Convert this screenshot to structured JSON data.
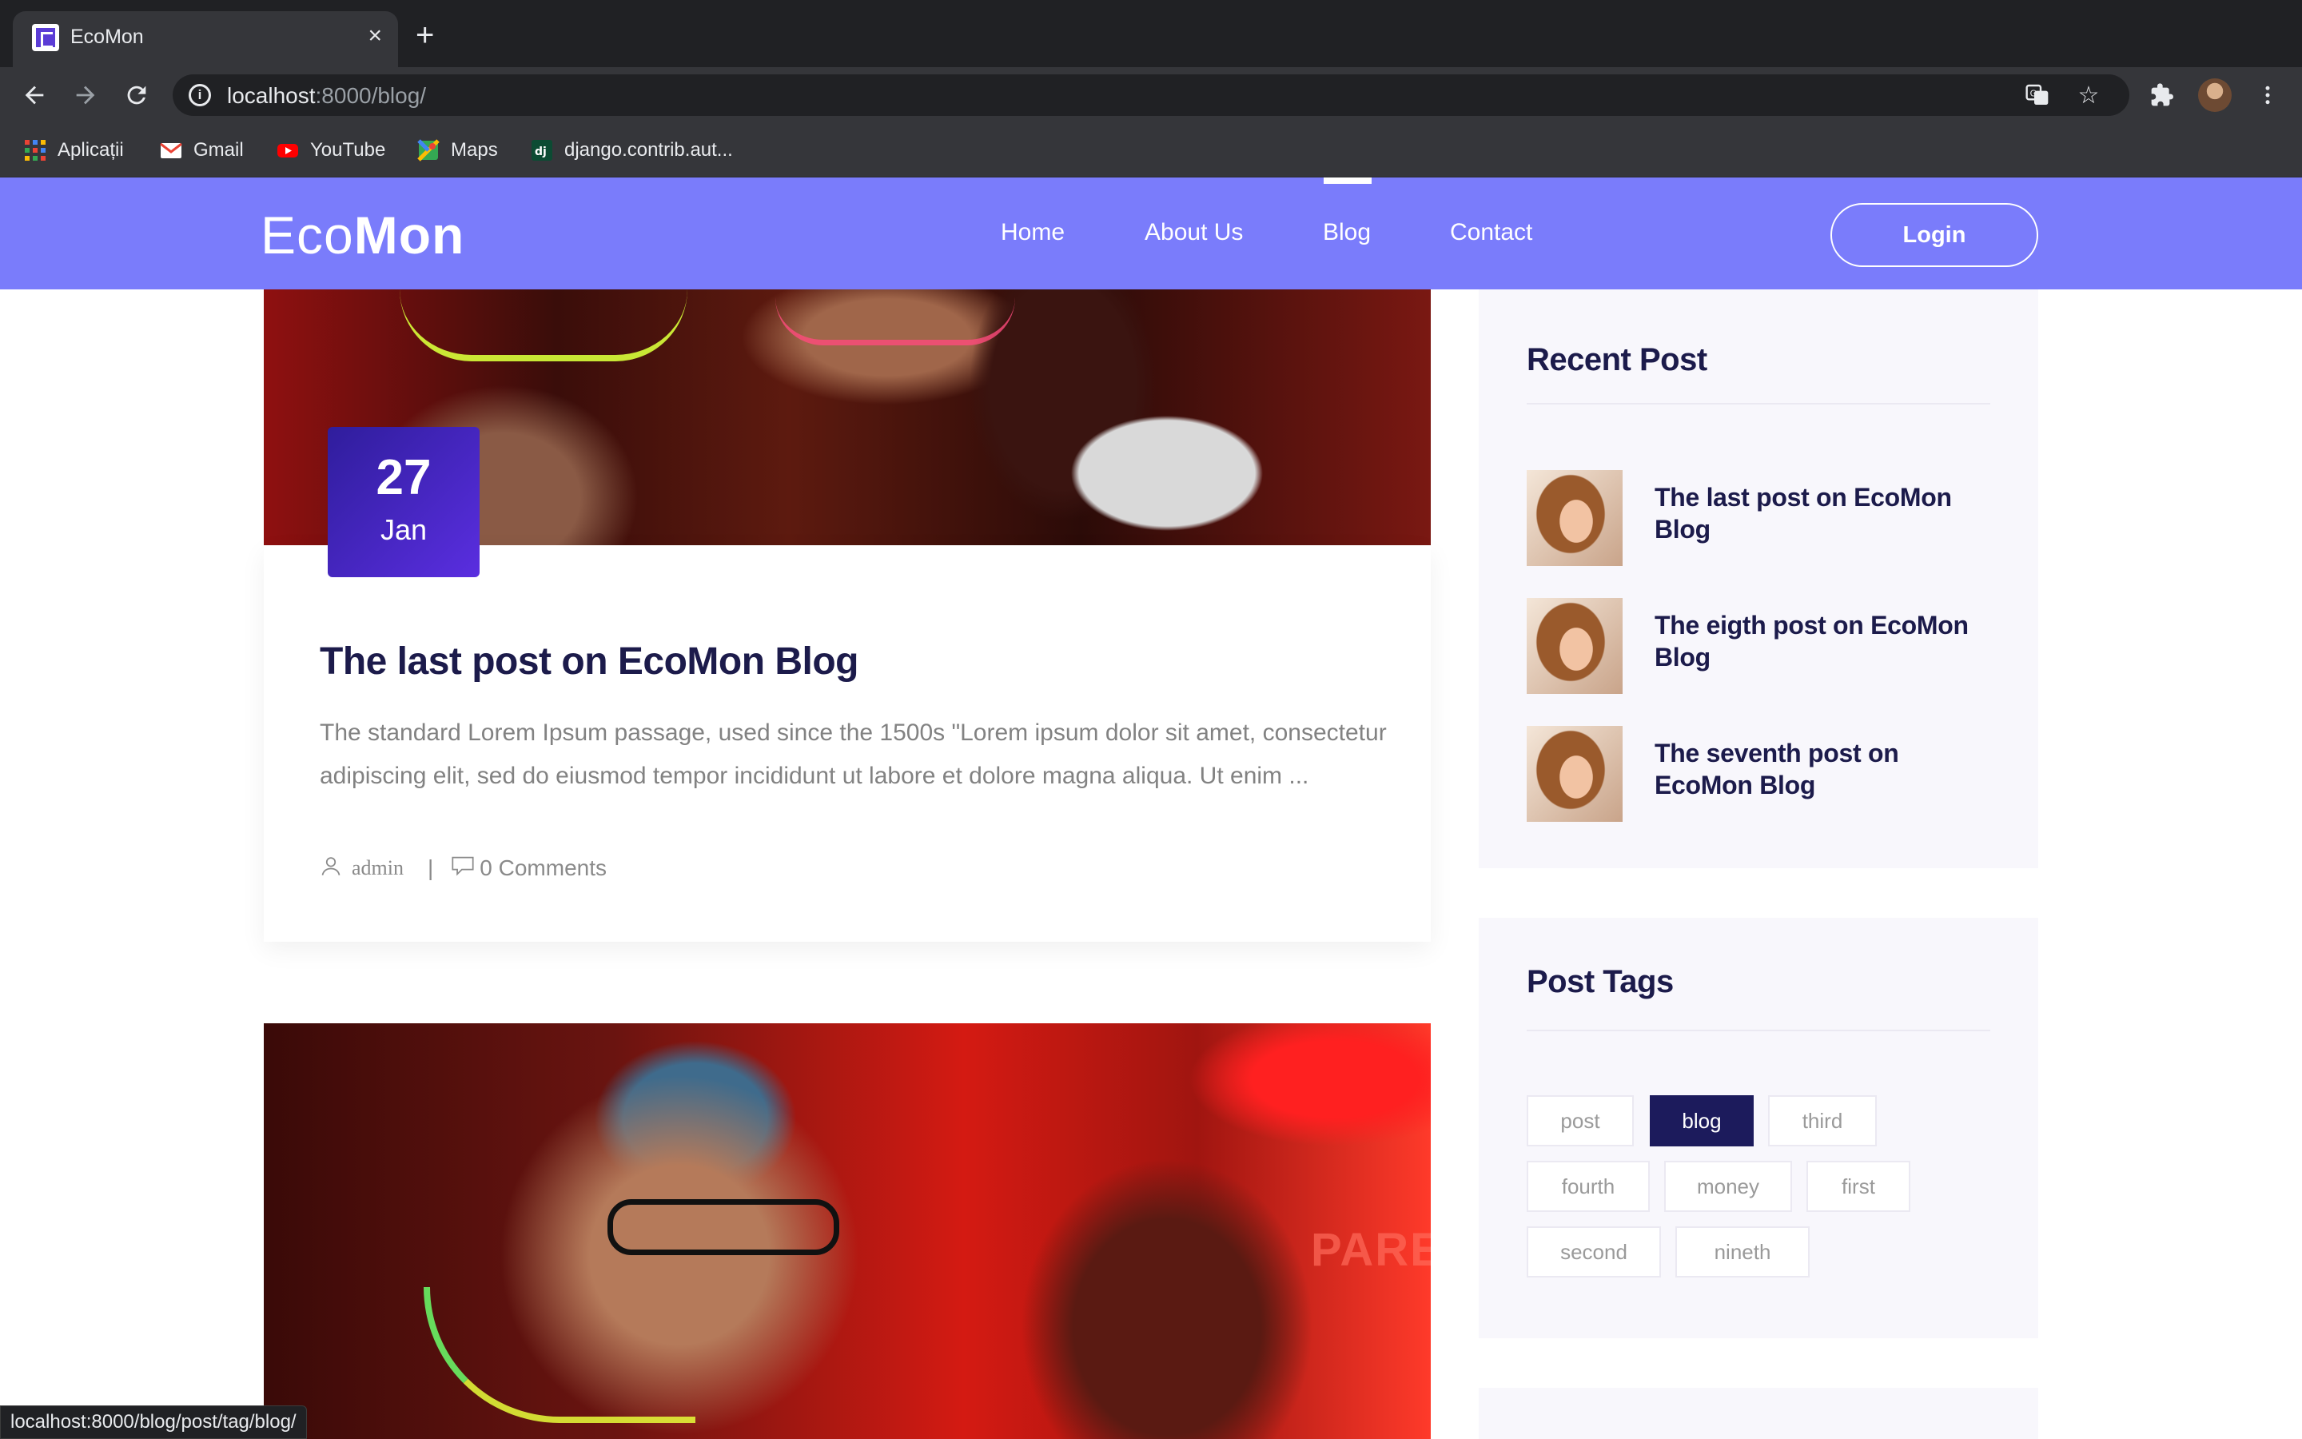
{
  "browser": {
    "tab_title": "EcoMon",
    "url_host": "localhost",
    "url_rest": ":8000/blog/",
    "bookmarks": [
      {
        "label": "Aplicații",
        "icon": "apps-grid-icon"
      },
      {
        "label": "Gmail",
        "icon": "gmail-icon"
      },
      {
        "label": "YouTube",
        "icon": "youtube-icon"
      },
      {
        "label": "Maps",
        "icon": "maps-icon"
      },
      {
        "label": "django.contrib.aut...",
        "icon": "django-icon"
      }
    ],
    "status_url": "localhost:8000/blog/post/tag/blog/"
  },
  "site": {
    "logo_light": "Eco",
    "logo_bold": "Mon",
    "nav": [
      {
        "label": "Home"
      },
      {
        "label": "About Us"
      },
      {
        "label": "Blog",
        "active": true
      },
      {
        "label": "Contact"
      }
    ],
    "login_label": "Login",
    "accent_color": "#7a7cfb"
  },
  "posts": [
    {
      "day": "27",
      "month": "Jan",
      "title": "The last post on EcoMon Blog",
      "excerpt": "The standard Lorem Ipsum passage, used since the 1500s \"Lorem ipsum dolor sit amet, consectetur adipiscing elit, sed do eiusmod tempor incididunt ut labore et dolore magna aliqua. Ut enim ...",
      "author": "admin",
      "comments": "0 Comments"
    }
  ],
  "sidebar": {
    "recent_title": "Recent Post",
    "recent_posts": [
      {
        "title": "The last post on EcoMon Blog"
      },
      {
        "title": "The eigth post on EcoMon Blog"
      },
      {
        "title": "The seventh post on EcoMon Blog"
      }
    ],
    "tags_title": "Post Tags",
    "tags": [
      {
        "label": "post"
      },
      {
        "label": "blog",
        "active": true
      },
      {
        "label": "third"
      },
      {
        "label": "fourth"
      },
      {
        "label": "money"
      },
      {
        "label": "first"
      },
      {
        "label": "second"
      },
      {
        "label": "nineth"
      }
    ]
  }
}
